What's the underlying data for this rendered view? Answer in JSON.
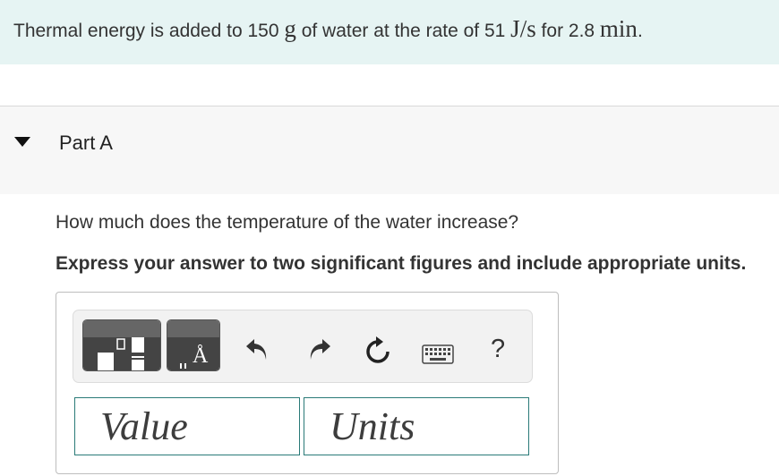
{
  "problem": {
    "pre": "Thermal energy is added to 150 ",
    "mass_unit": "g",
    "mid": " of water at the rate of 51 ",
    "rate_unit_num": "J",
    "rate_unit_sep": "/",
    "rate_unit_den": "s",
    "post": " for 2.8 ",
    "time_unit": "min",
    "end": "."
  },
  "part": {
    "title": "Part A"
  },
  "question": "How much does the temperature of the water increase?",
  "instruction": "Express your answer to two significant figures and include appropriate units.",
  "toolbar": {
    "templates_icon": "fraction-template-icon",
    "units_icon": "angstrom-units-icon",
    "units_glyph": "Å",
    "undo_icon": "undo-icon",
    "redo_icon": "redo-icon",
    "reset_icon": "reset-icon",
    "keyboard_icon": "keyboard-icon",
    "help_label": "?"
  },
  "answer": {
    "value_placeholder": "Value",
    "units_placeholder": "Units"
  },
  "colors": {
    "banner_bg": "#e6f4f3",
    "field_border": "#2a7a78"
  }
}
